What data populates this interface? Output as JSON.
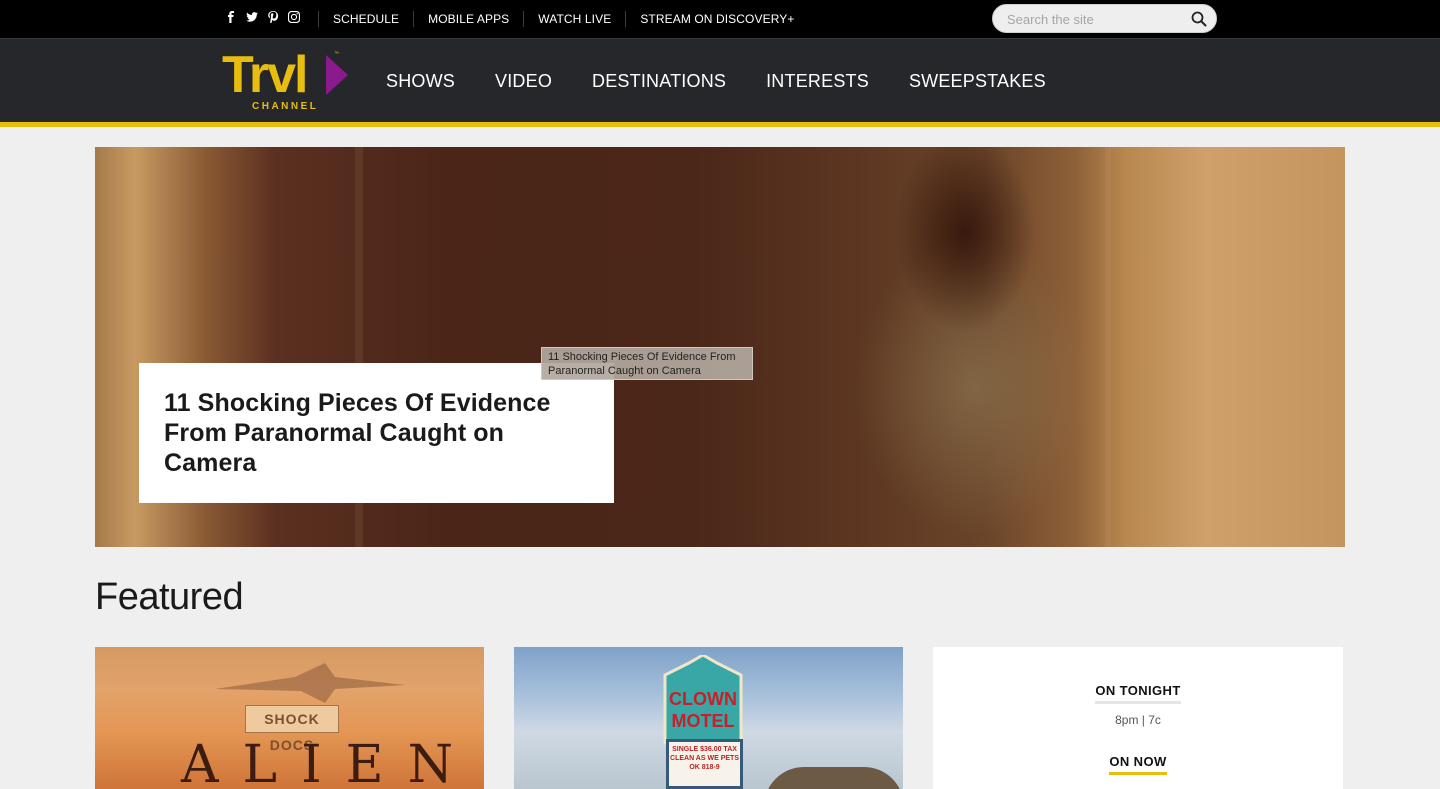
{
  "brand": {
    "logo_text": "Trvl",
    "logo_subtext": "CHANNEL",
    "logo_tm": "™",
    "accent_color": "#e7bd10",
    "logo_play_color": "#8c1a8f"
  },
  "topbar": {
    "social": [
      {
        "name": "facebook-icon",
        "glyph": "f"
      },
      {
        "name": "twitter-icon",
        "glyph": "t"
      },
      {
        "name": "pinterest-icon",
        "glyph": "p"
      },
      {
        "name": "instagram-icon",
        "glyph": "i"
      }
    ],
    "links": [
      "SCHEDULE",
      "MOBILE APPS",
      "WATCH LIVE",
      "STREAM ON DISCOVERY+"
    ],
    "search_placeholder": "Search the site"
  },
  "nav": {
    "items": [
      "SHOWS",
      "VIDEO",
      "DESTINATIONS",
      "INTERESTS",
      "SWEEPSTAKES"
    ]
  },
  "hero": {
    "title": "11 Shocking Pieces Of Evidence From Paranormal Caught on Camera",
    "tooltip": "11 Shocking Pieces Of Evidence From Paranormal Caught on Camera"
  },
  "featured": {
    "heading": "Featured",
    "cards": [
      {
        "badge": "SHOCK DOCS",
        "title_art": "ALIEN"
      },
      {
        "marquee": "SINGLE $36.00 TAX CLEAN AS WE PETS OK 818-9"
      }
    ]
  },
  "schedule": {
    "on_tonight_label": "ON TONIGHT",
    "time": "8pm | 7c",
    "on_now_label": "ON NOW"
  }
}
